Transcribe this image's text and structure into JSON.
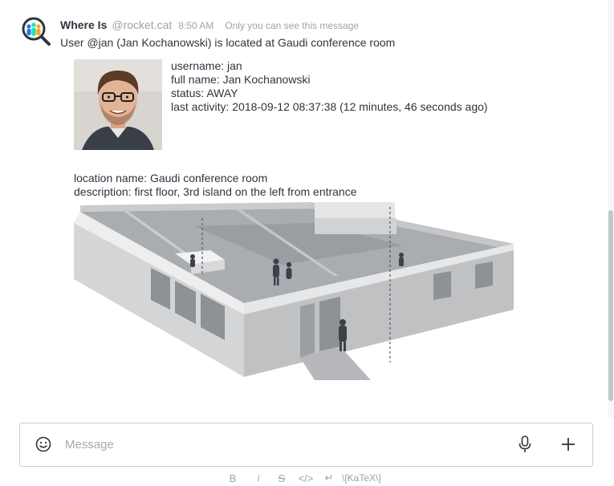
{
  "message": {
    "author": "Where Is",
    "handle": "@rocket.cat",
    "time": "8:50 AM",
    "private_note": "Only you can see this message",
    "text": "User @jan (Jan Kochanowski) is located at Gaudi conference room"
  },
  "attachment": {
    "fields": [
      "username: jan",
      "full name: Jan Kochanowski",
      "status: AWAY",
      "last activity: 2018-09-12 08:37:38 (12 minutes, 46 seconds ago)"
    ],
    "location": [
      "location name: Gaudi conference room",
      "description: first floor, 3rd island on the left from entrance"
    ]
  },
  "composer": {
    "placeholder": "Message"
  },
  "toolbar": {
    "bold": "B",
    "italic": "i",
    "strike": "S",
    "code": "</>",
    "multiline": "↵",
    "katex": "\\[KaTeX\\]"
  },
  "colors": {
    "text": "#2f343d",
    "muted": "#9ea2a8",
    "border": "#cbced1",
    "bot_avatar_blue": "#1d74f5",
    "bot_avatar_green": "#2de0a5",
    "bot_avatar_orange": "#f5a623"
  },
  "icons": {
    "bot_avatar": "magnifier-people-icon",
    "emoji": "smiley-icon",
    "mic": "microphone-icon",
    "add": "plus-icon"
  }
}
